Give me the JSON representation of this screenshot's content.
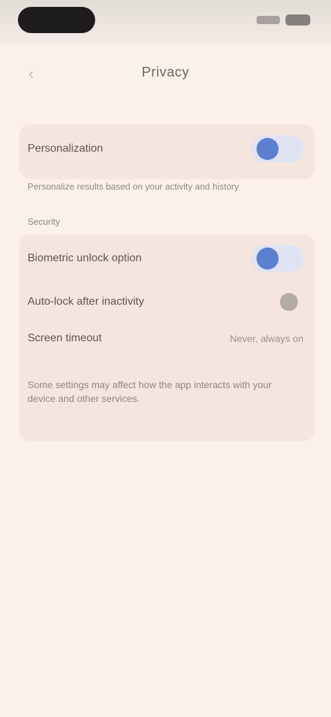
{
  "status_bar": {
    "icons": [
      "signal-icon",
      "battery-icon"
    ]
  },
  "header": {
    "title": "Privacy",
    "back_icon": "chevron-left-icon"
  },
  "settings": {
    "toggle_1_label": "Personalization",
    "toggle_1_description": "Personalize results based on your activity and history",
    "section_label": "Security",
    "toggle_2_label": "Biometric unlock option",
    "toggle_3_label": "Auto-lock after inactivity",
    "timeout_label": "Screen timeout",
    "timeout_value": "Never, always on",
    "footer_text": "Some settings may affect how the app interacts with your device and other services."
  },
  "toggle_states": {
    "toggle_1": true,
    "toggle_2": true,
    "toggle_3": false
  },
  "colors": {
    "background": "#fbf1e9",
    "card": "#f4e6df",
    "accent": "#5d7fd0"
  }
}
